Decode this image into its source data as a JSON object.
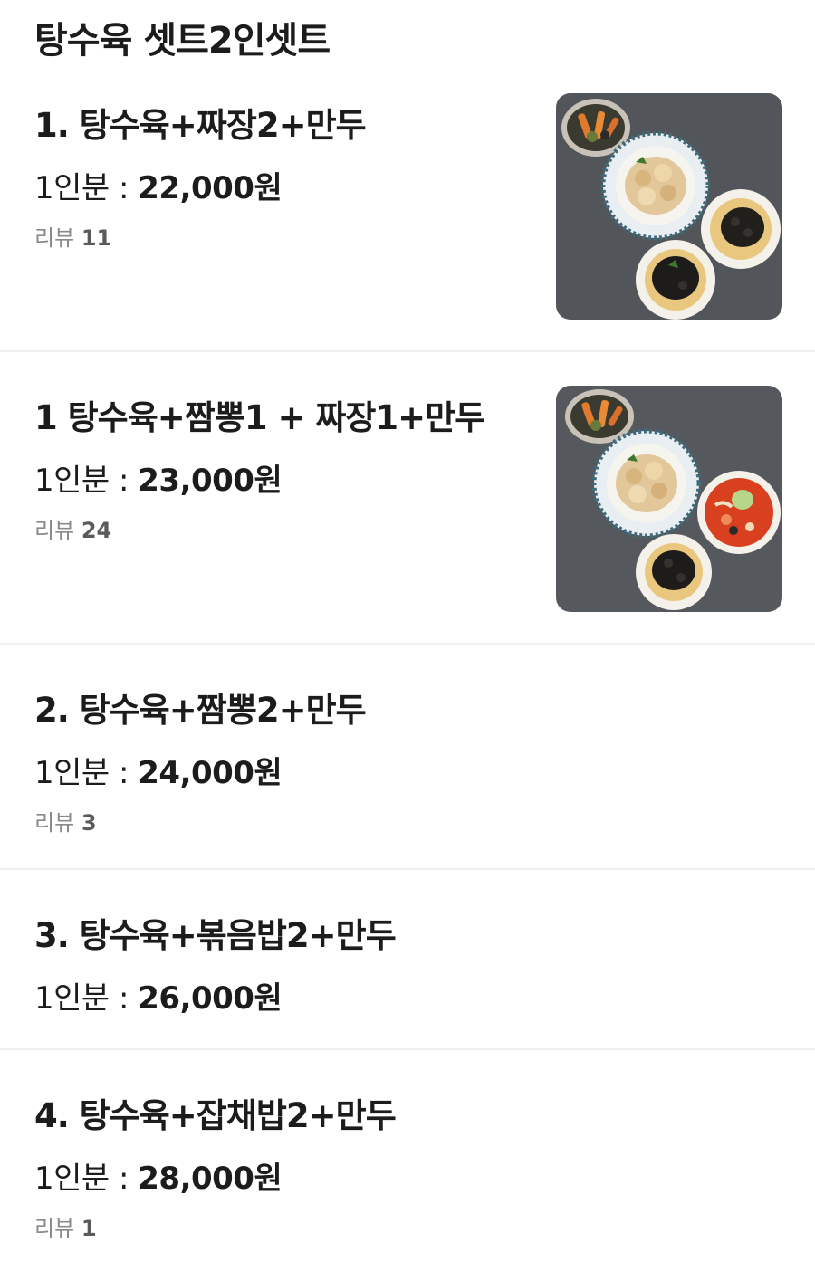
{
  "section": {
    "title": "탕수육 셋트2인셋트"
  },
  "items": [
    {
      "name": "1. 탕수육+짜장2+만두",
      "price_prefix": "1인분 : ",
      "price": "22,000원",
      "review_label": "리뷰",
      "review_count": "11",
      "image_icon": "food-set-jjajang-photo"
    },
    {
      "name": "1  탕수육+짬뽕1 + 짜장1+만두",
      "price_prefix": "1인분 : ",
      "price": "23,000원",
      "review_label": "리뷰",
      "review_count": "24",
      "image_icon": "food-set-jjamppong-photo"
    },
    {
      "name": "2. 탕수육+짬뽕2+만두",
      "price_prefix": "1인분 : ",
      "price": "24,000원",
      "review_label": "리뷰",
      "review_count": "3"
    },
    {
      "name": "3. 탕수육+볶음밥2+만두",
      "price_prefix": "1인분 : ",
      "price": "26,000원"
    },
    {
      "name": "4. 탕수육+잡채밥2+만두",
      "price_prefix": "1인분 : ",
      "price": "28,000원",
      "review_label": "리뷰",
      "review_count": "1"
    }
  ],
  "colors": {
    "text": "#1c1c1c",
    "review_label": "#8a8a8a",
    "divider": "#efefef",
    "plate_bg": "#55595d"
  }
}
